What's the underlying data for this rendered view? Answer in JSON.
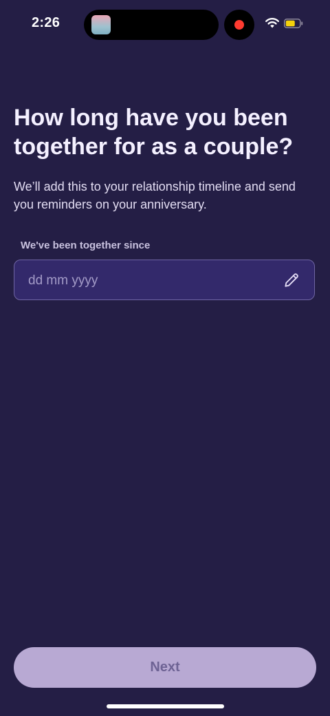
{
  "status_bar": {
    "time": "2:26",
    "icons": [
      "app-thumbnail-icon",
      "recording-indicator-icon",
      "wifi-icon",
      "battery-icon"
    ],
    "recording_color": "#ff3b30",
    "battery_color": "#f5d10b"
  },
  "main": {
    "heading": "How long have you been together for as a couple?",
    "description": "We’ll add this to your relationship timeline and send you reminders on your anniversary.",
    "date_field": {
      "label": "We've been together since",
      "placeholder": "dd mm yyyy",
      "value": "",
      "icon": "pencil-icon"
    }
  },
  "footer": {
    "next_label": "Next",
    "next_enabled": false
  },
  "colors": {
    "background": "#241e45",
    "field_background": "#33296b",
    "button_background": "#b8a9d3"
  }
}
